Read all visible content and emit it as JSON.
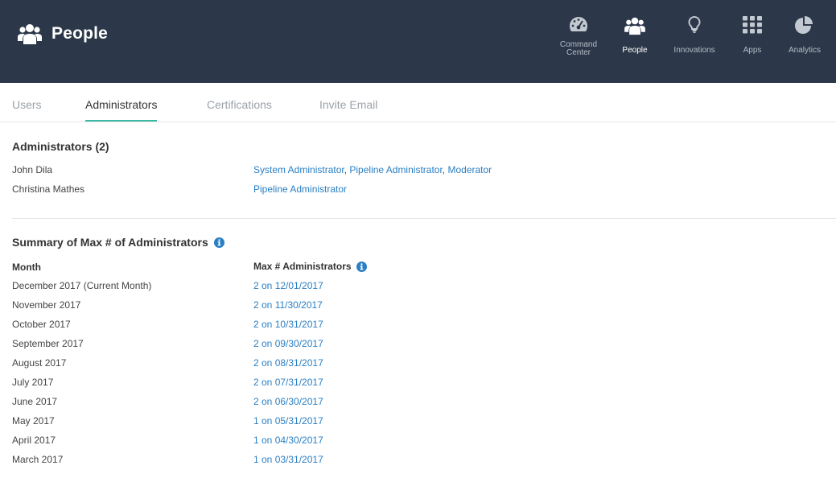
{
  "header": {
    "title": "People",
    "brand_icon": "people-group-icon",
    "nav": [
      {
        "label": "Command\nCenter",
        "icon": "dashboard-gauge-icon",
        "active": false
      },
      {
        "label": "People",
        "icon": "people-group-icon",
        "active": true
      },
      {
        "label": "Innovations",
        "icon": "lightbulb-icon",
        "active": false
      },
      {
        "label": "Apps",
        "icon": "apps-grid-icon",
        "active": false
      },
      {
        "label": "Analytics",
        "icon": "pie-chart-icon",
        "active": false
      }
    ]
  },
  "tabs": [
    {
      "label": "Users",
      "active": false
    },
    {
      "label": "Administrators",
      "active": true
    },
    {
      "label": "Certifications",
      "active": false
    },
    {
      "label": "Invite Email",
      "active": false
    }
  ],
  "administrators": {
    "title": "Administrators (2)",
    "rows": [
      {
        "name": "John Dila",
        "roles": [
          "System Administrator",
          "Pipeline Administrator",
          "Moderator"
        ]
      },
      {
        "name": "Christina Mathes",
        "roles": [
          "Pipeline Administrator"
        ]
      }
    ]
  },
  "summary": {
    "title": "Summary of Max # of Administrators",
    "col_month": "Month",
    "col_max": "Max # Administrators",
    "rows": [
      {
        "month": "December 2017 (Current Month)",
        "max": "2 on 12/01/2017"
      },
      {
        "month": "November 2017",
        "max": "2 on 11/30/2017"
      },
      {
        "month": "October 2017",
        "max": "2 on 10/31/2017"
      },
      {
        "month": "September 2017",
        "max": "2 on 09/30/2017"
      },
      {
        "month": "August 2017",
        "max": "2 on 08/31/2017"
      },
      {
        "month": "July 2017",
        "max": "2 on 07/31/2017"
      },
      {
        "month": "June 2017",
        "max": "2 on 06/30/2017"
      },
      {
        "month": "May 2017",
        "max": "1 on 05/31/2017"
      },
      {
        "month": "April 2017",
        "max": "1 on 04/30/2017"
      },
      {
        "month": "March 2017",
        "max": "1 on 03/31/2017"
      }
    ]
  },
  "colors": {
    "header_bg": "#2c3849",
    "accent": "#3bb8a4",
    "link": "#2a7fc4",
    "info": "#2a7fc4"
  }
}
